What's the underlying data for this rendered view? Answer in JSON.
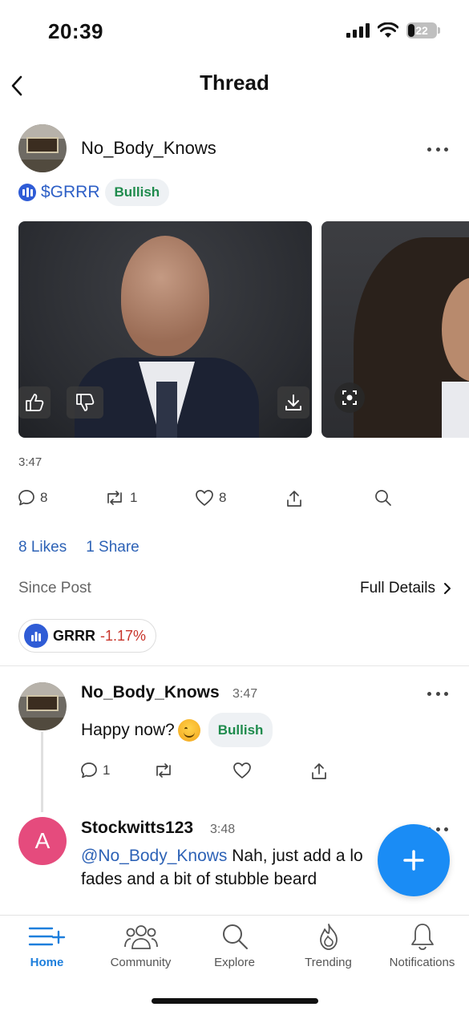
{
  "status_bar": {
    "time": "20:39",
    "battery": "22"
  },
  "header": {
    "title": "Thread"
  },
  "post": {
    "author": "No_Body_Knows",
    "ticker": "$GRRR",
    "sentiment": "Bullish",
    "time": "3:47",
    "actions": {
      "comments": "8",
      "reshares": "1",
      "likes": "8"
    },
    "stats": {
      "likes": "8 Likes",
      "shares": "1 Share"
    },
    "since_label": "Since Post",
    "full_details": "Full Details",
    "performance": {
      "symbol": "GRRR",
      "change": "-1.17%"
    }
  },
  "replies": [
    {
      "author": "No_Body_Knows",
      "time": "3:47",
      "text": "Happy now?",
      "sentiment": "Bullish",
      "comments": "1"
    },
    {
      "author": "Stockwitts123",
      "time": "3:48",
      "avatar_letter": "A",
      "mention": "@No_Body_Knows",
      "text_line1": " Nah, just add a lo",
      "text_line2": "fades and a bit of stubble beard"
    }
  ],
  "nav": [
    {
      "label": "Home",
      "icon": "home-feed-icon"
    },
    {
      "label": "Community",
      "icon": "community-icon"
    },
    {
      "label": "Explore",
      "icon": "search-icon"
    },
    {
      "label": "Trending",
      "icon": "flame-icon"
    },
    {
      "label": "Notifications",
      "icon": "bell-icon"
    }
  ],
  "colors": {
    "accent": "#1a8cf5",
    "bullish": "#1f8b4d",
    "negative": "#c8342a",
    "link": "#2d62b6"
  }
}
